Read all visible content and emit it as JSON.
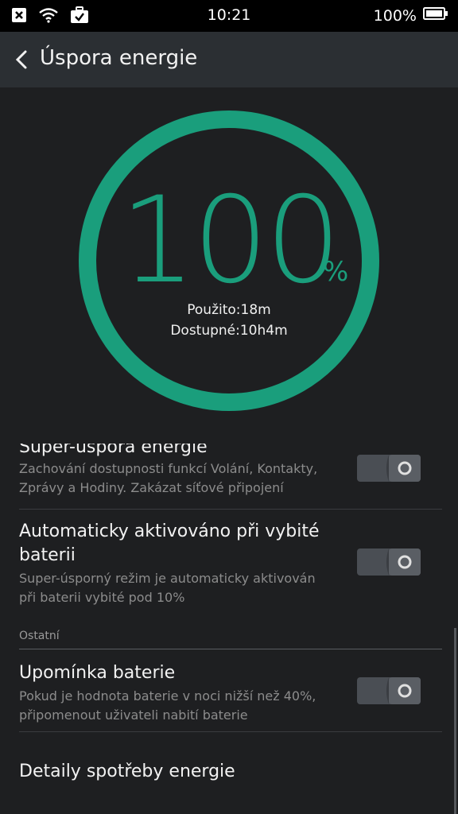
{
  "status": {
    "time": "10:21",
    "battery": "100%"
  },
  "header": {
    "title": "Úspora energie"
  },
  "gauge": {
    "value": "100",
    "unit": "%",
    "used": "Použito:18m",
    "available": "Dostupné:10h4m",
    "level": 1.0,
    "color": "#1a9e7c"
  },
  "settings": {
    "super_saver": {
      "title": "Super-úspora energie",
      "subtitle_line1": "Zachování dostupnosti funkcí Volání, Kontakty,",
      "subtitle_line2": "Zprávy a Hodiny. Zakázat síťové připojení",
      "enabled": false
    },
    "auto_activate": {
      "title_line1": "Automaticky aktivováno při vybité",
      "title_line2": "baterii",
      "subtitle_line1": "Super-úsporný režim je automaticky aktivován",
      "subtitle_line2": "při baterii vybité pod 10%",
      "enabled": false
    },
    "section_other": "Ostatní",
    "reminder": {
      "title": "Upomínka baterie",
      "subtitle_line1": "Pokud je hodnota baterie v noci nižší než 40%,",
      "subtitle_line2": "připomenout uživateli nabití baterie",
      "enabled": false
    },
    "details": {
      "title": "Detaily spotřeby energie"
    }
  },
  "icons": [
    "close-box-icon",
    "wifi-icon",
    "briefcase-check-icon",
    "battery-icon",
    "back-chevron-icon",
    "toggle-switch-icon"
  ]
}
